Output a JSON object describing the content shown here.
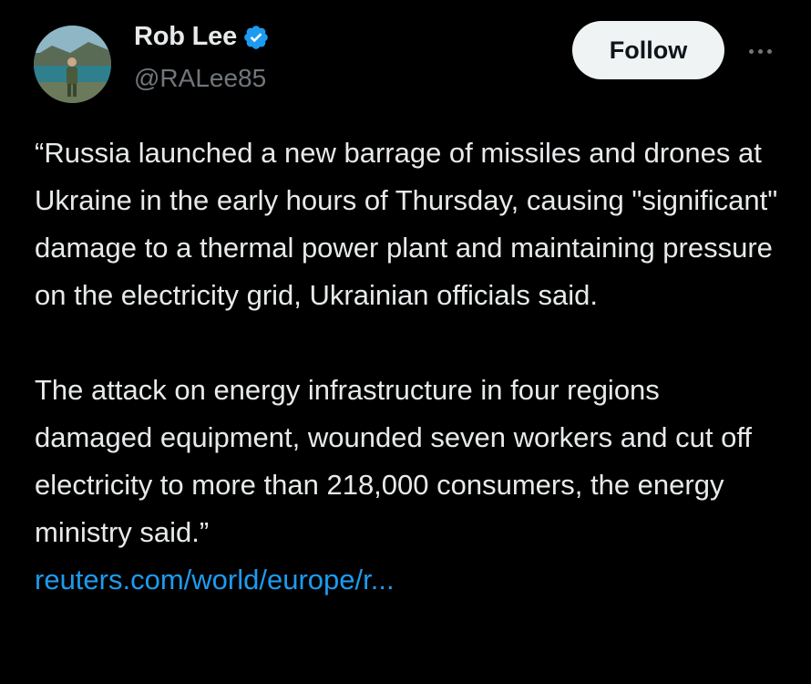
{
  "author": {
    "display_name": "Rob Lee",
    "handle": "@RALee85",
    "verified": true,
    "avatar_icon": "profile-photo"
  },
  "actions": {
    "follow_label": "Follow",
    "more_icon": "more-horizontal-icon"
  },
  "tweet": {
    "paragraphs": [
      "“Russia launched a new barrage of missiles and drones at Ukraine in the early hours of Thursday, causing \"significant\" damage to a thermal power plant and maintaining pressure on the electricity grid, Ukrainian officials said.",
      "The attack on energy infrastructure in four regions damaged equipment, wounded seven workers and cut off electricity to more than 218,000 consumers, the energy ministry said.”"
    ],
    "link_text": "reuters.com/world/europe/r..."
  },
  "colors": {
    "background": "#000000",
    "text": "#e7e9ea",
    "secondary_text": "#71767b",
    "link": "#1d9bf0",
    "verified": "#1d9bf0",
    "follow_button_bg": "#eff3f4"
  }
}
